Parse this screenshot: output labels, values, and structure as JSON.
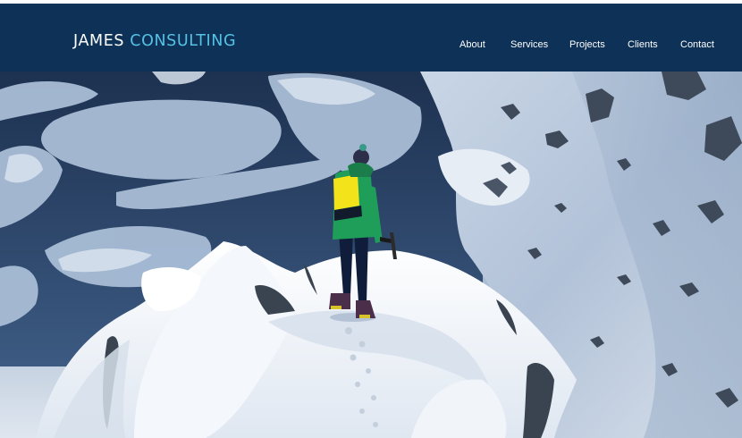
{
  "header": {
    "logo": {
      "first": "JAMES",
      "second": "CONSULTING"
    },
    "nav": [
      {
        "label": "About"
      },
      {
        "label": "Services"
      },
      {
        "label": "Projects"
      },
      {
        "label": "Clients"
      },
      {
        "label": "Contact"
      }
    ]
  },
  "hero": {
    "image": "aerial-snowy-mountain-summit-climber"
  },
  "colors": {
    "header_bg": "#0e3257",
    "logo_accent": "#56c1e4",
    "nav_text": "#ffffff"
  }
}
